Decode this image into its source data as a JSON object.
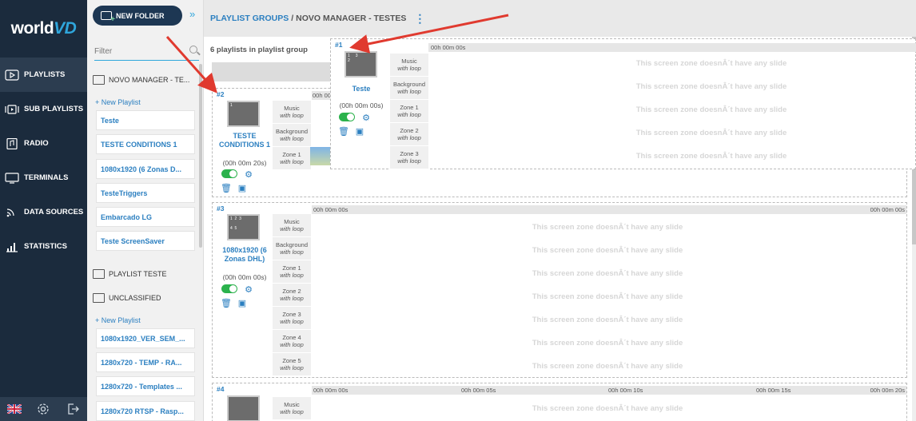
{
  "app": {
    "logo_prefix": "world",
    "logo_suffix": "VD"
  },
  "nav": {
    "items": [
      {
        "label": "PLAYLISTS",
        "icon": "play-icon"
      },
      {
        "label": "SUB PLAYLISTS",
        "icon": "sub-playlist-icon"
      },
      {
        "label": "RADIO",
        "icon": "music-icon"
      },
      {
        "label": "TERMINALS",
        "icon": "monitor-icon"
      },
      {
        "label": "DATA SOURCES",
        "icon": "rss-icon"
      },
      {
        "label": "STATISTICS",
        "icon": "bar-chart-icon"
      }
    ],
    "bottom_icons": [
      "uk-flag-icon",
      "settings-icon",
      "logout-icon"
    ]
  },
  "sidebar": {
    "new_folder": "NEW FOLDER",
    "filter_placeholder": "Filter",
    "folders": [
      {
        "name": "NOVO MANAGER - TE..."
      },
      {
        "name": "PLAYLIST TESTE"
      },
      {
        "name": "UNCLASSIFIED"
      }
    ],
    "new_playlist": "+ New Playlist",
    "group1_items": [
      "Teste",
      "TESTE CONDITIONS 1",
      "1080x1920 (6 Zonas D...",
      "TesteTriggers",
      "Embarcado LG",
      "Teste ScreenSaver"
    ],
    "group3_items": [
      "1080x1920_VER_SEM_...",
      "1280x720 - TEMP - RA...",
      "1280x720 - Templates ...",
      "1280x720 RTSP - Rasp..."
    ]
  },
  "header": {
    "crumb_root": "PLAYLIST GROUPS",
    "separator": "/",
    "crumb_current": "NOVO MANAGER - TESTES",
    "menu_icon": "more-vertical-icon"
  },
  "main": {
    "count_label": "6 playlists in playlist group",
    "no_slide": "This screen zone doesnÂ´t have any slide",
    "cards": [
      {
        "num": "#1",
        "name": "Teste",
        "duration": "(00h 00m 00s)",
        "zones": [
          [
            "Music",
            "with loop"
          ],
          [
            "Background",
            "with loop"
          ],
          [
            "Zone 1",
            "with loop"
          ],
          [
            "Zone 2",
            "with loop"
          ],
          [
            "Zone 3",
            "with loop"
          ]
        ],
        "time_start": "00h 00m 00s"
      },
      {
        "num": "#2",
        "name": "TESTE CONDITIONS 1",
        "duration": "(00h 00m 20s)",
        "zones": [
          [
            "Music",
            "with loop"
          ],
          [
            "Background",
            "with loop"
          ],
          [
            "Zone 1",
            "with loop"
          ]
        ],
        "time_start": "00h 00"
      },
      {
        "num": "#3",
        "name": "1080x1920 (6 Zonas DHL)",
        "duration": "(00h 00m 00s)",
        "zones": [
          [
            "Music",
            "with loop"
          ],
          [
            "Background",
            "with loop"
          ],
          [
            "Zone 1",
            "with loop"
          ],
          [
            "Zone 2",
            "with loop"
          ],
          [
            "Zone 3",
            "with loop"
          ],
          [
            "Zone 4",
            "with loop"
          ],
          [
            "Zone 5",
            "with loop"
          ]
        ],
        "time_start": "00h 00m 00s",
        "time_end": "00h 00m 00s"
      },
      {
        "num": "#4",
        "zones": [
          [
            "Music",
            "with loop"
          ]
        ],
        "ticks": [
          "00h 00m 00s",
          "00h 00m 05s",
          "00h 00m 10s",
          "00h 00m 15s",
          "00h 00m 20s"
        ]
      }
    ]
  },
  "colors": {
    "nav_bg": "#1b2b3d",
    "accent": "#2b7fc0",
    "toggle_on": "#2bb24c",
    "annotation_arrow": "#e03a2f"
  }
}
